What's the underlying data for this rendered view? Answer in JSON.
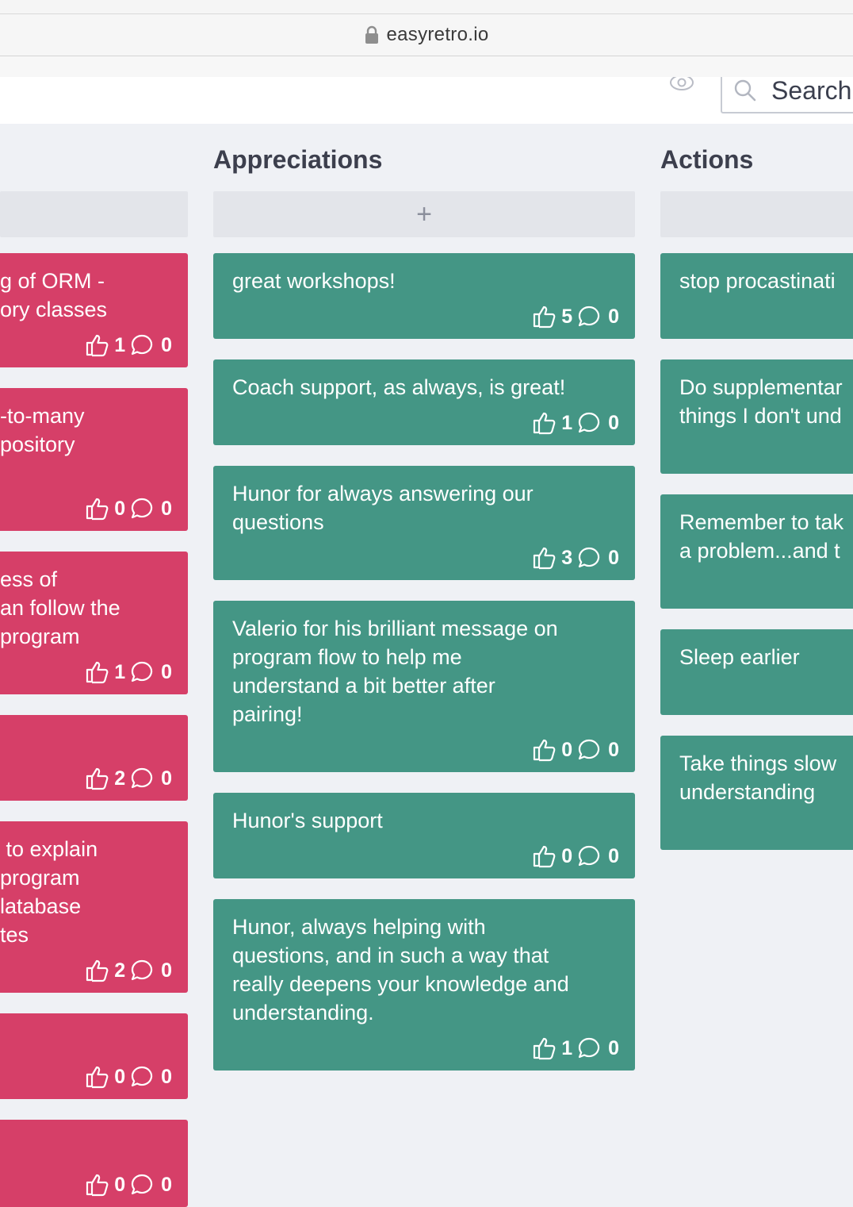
{
  "browser": {
    "url": "easyretro.io"
  },
  "toolbar": {
    "search_placeholder": "Search"
  },
  "columns": [
    {
      "title": "",
      "color": "#d63f68",
      "cards": [
        {
          "lines": [
            "g of ORM -",
            "ory classes"
          ],
          "likes": "1",
          "comments": "0"
        },
        {
          "lines": [
            "-to-many",
            "pository"
          ],
          "likes": "0",
          "comments": "0"
        },
        {
          "lines": [
            "ess of",
            "an follow the",
            "program"
          ],
          "likes": "1",
          "comments": "0"
        },
        {
          "lines": [],
          "likes": "2",
          "comments": "0"
        },
        {
          "lines": [
            " to explain",
            "program",
            "latabase",
            "tes"
          ],
          "likes": "2",
          "comments": "0"
        },
        {
          "lines": [],
          "likes": "0",
          "comments": "0"
        },
        {
          "lines": [],
          "likes": "0",
          "comments": "0"
        }
      ]
    },
    {
      "title": "Appreciations",
      "add_label": "+",
      "color": "#449685",
      "cards": [
        {
          "lines": [
            "great workshops!"
          ],
          "likes": "5",
          "comments": "0"
        },
        {
          "lines": [
            "Coach support, as always, is great!"
          ],
          "likes": "1",
          "comments": "0"
        },
        {
          "lines": [
            "Hunor for always answering our",
            "questions"
          ],
          "likes": "3",
          "comments": "0"
        },
        {
          "lines": [
            "Valerio for his brilliant message on",
            "program flow to help me",
            "understand a bit better after",
            "pairing!"
          ],
          "likes": "0",
          "comments": "0"
        },
        {
          "lines": [
            "Hunor's support"
          ],
          "likes": "0",
          "comments": "0"
        },
        {
          "lines": [
            "Hunor, always helping with",
            "questions, and in such a way that",
            "really deepens your knowledge and",
            "understanding."
          ],
          "likes": "1",
          "comments": "0"
        }
      ]
    },
    {
      "title": "Actions",
      "color": "#449685",
      "cards": [
        {
          "lines": [
            "stop procastinati"
          ]
        },
        {
          "lines": [
            "Do supplementar",
            "things I don't und"
          ]
        },
        {
          "lines": [
            "Remember to tak",
            "a problem...and t"
          ]
        },
        {
          "lines": [
            "Sleep earlier"
          ]
        },
        {
          "lines": [
            "Take things slow",
            "understanding"
          ]
        }
      ]
    }
  ]
}
